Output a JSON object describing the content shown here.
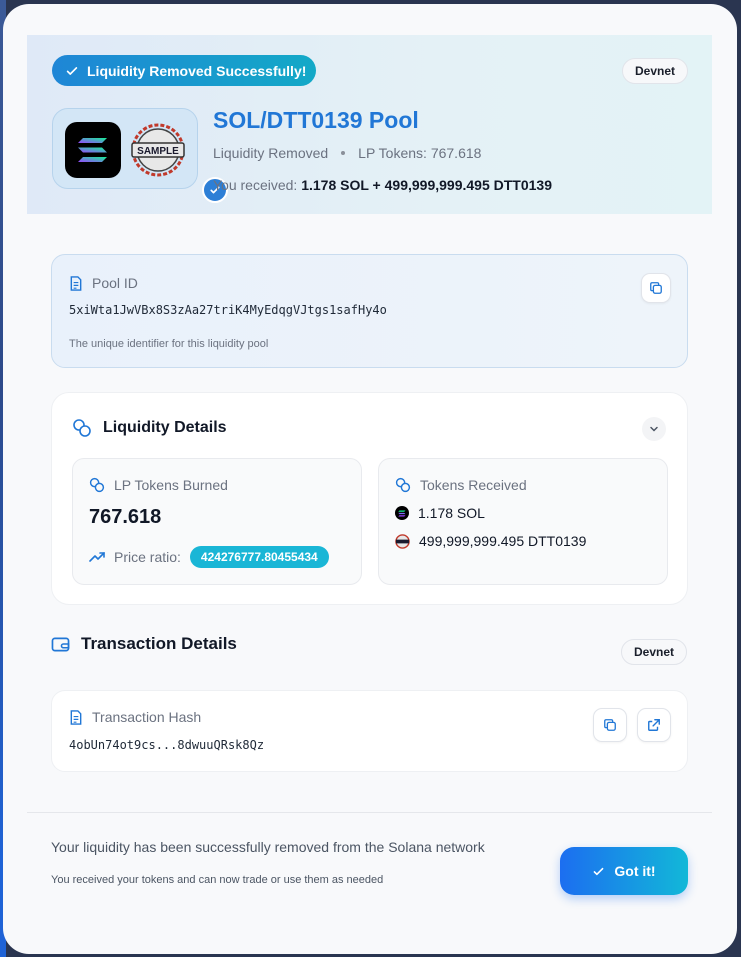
{
  "hero": {
    "success_label": "Liquidity Removed Successfully!",
    "network_badge": "Devnet",
    "pool_title": "SOL/DTT0139 Pool",
    "status": "Liquidity Removed",
    "lp_tokens_text": "LP Tokens: 767.618",
    "received_prefix": "You received:",
    "received_value": "1.178 SOL + 499,999,999.495 DTT0139",
    "sample_logo_text": "SAMPLE"
  },
  "pool_id": {
    "label": "Pool ID",
    "value": "5xiWta1JwVBx8S3zAa27triK4MyEdqgVJtgs1safHy4o",
    "note": "The unique identifier for this liquidity pool"
  },
  "liquidity": {
    "title": "Liquidity Details",
    "burned_label": "LP Tokens Burned",
    "burned_value": "767.618",
    "price_ratio_label": "Price ratio:",
    "price_ratio_value": "424276777.80455434",
    "received_label": "Tokens Received",
    "tokens": [
      {
        "amount": "1.178 SOL",
        "icon": "solana-icon"
      },
      {
        "amount": "499,999,999.495 DTT0139",
        "icon": "dtt-token-icon"
      }
    ]
  },
  "transaction": {
    "title": "Transaction Details",
    "network_badge": "Devnet",
    "hash_label": "Transaction Hash",
    "hash_value": "4obUn74ot9cs...8dwuuQRsk8Qz"
  },
  "footer": {
    "main_text": "Your liquidity has been successfully removed from the Solana network",
    "sub_text": "You received your tokens and can now trade or use them as needed",
    "button_label": "Got it!"
  },
  "colors": {
    "accent": "#2177d6",
    "cyan": "#1ab6d6",
    "pill_gradient_start": "#1f86d6",
    "pill_gradient_end": "#13a9c7"
  }
}
